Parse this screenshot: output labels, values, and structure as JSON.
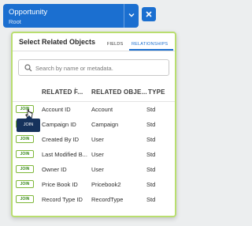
{
  "context": {
    "object": "Opportunity",
    "path": "Root"
  },
  "panel": {
    "title": "Select Related Objects",
    "tabs": [
      {
        "label": "FIELDS",
        "active": false
      },
      {
        "label": "RELATIONSHIPS",
        "active": true
      }
    ],
    "search_placeholder": "Search by name or metadata."
  },
  "table": {
    "columns": [
      "RELATED F...",
      "RELATED OBJE...",
      "TYPE"
    ],
    "join_label": "JOIN",
    "rows": [
      {
        "field": "Account ID",
        "object": "Account",
        "type": "Std"
      },
      {
        "field": "Campaign ID",
        "object": "Campaign",
        "type": "Std"
      },
      {
        "field": "Created By ID",
        "object": "User",
        "type": "Std"
      },
      {
        "field": "Last Modified B...",
        "object": "User",
        "type": "Std"
      },
      {
        "field": "Owner ID",
        "object": "User",
        "type": "Std"
      },
      {
        "field": "Price Book ID",
        "object": "Pricebook2",
        "type": "Std"
      },
      {
        "field": "Record Type ID",
        "object": "RecordType",
        "type": "Std"
      }
    ]
  },
  "tooltip": "JOIN",
  "colors": {
    "accent": "#1b6fd0",
    "join_green": "#7fb83a",
    "panel_border": "#b9de6f",
    "tooltip_bg": "#16325c"
  }
}
